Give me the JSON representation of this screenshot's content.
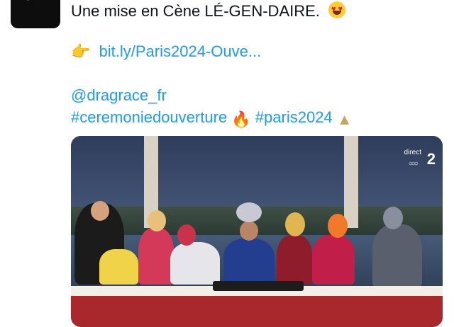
{
  "account": {
    "logo": "tv",
    "avatar_bg": "#0d0d0d",
    "dot_color": "#ff3b2f"
  },
  "tweet": {
    "line1": "Une mise en Cène LÉ-GEN-DAIRE.",
    "link": "bit.ly/Paris2024-Ouve...",
    "mention": "@dragrace_fr",
    "hashtag1": "#ceremoniedouverture",
    "hashtag2": "#paris2024",
    "link_color": "#1d9bf0"
  },
  "media": {
    "channel_direct": "direct",
    "channel_number": "2"
  },
  "icons": [
    "heart-eyes-emoji",
    "pointing-hand-emoji",
    "olympic-flame-emoji",
    "eiffel-tower-emoji",
    "olympic-rings-icon"
  ]
}
